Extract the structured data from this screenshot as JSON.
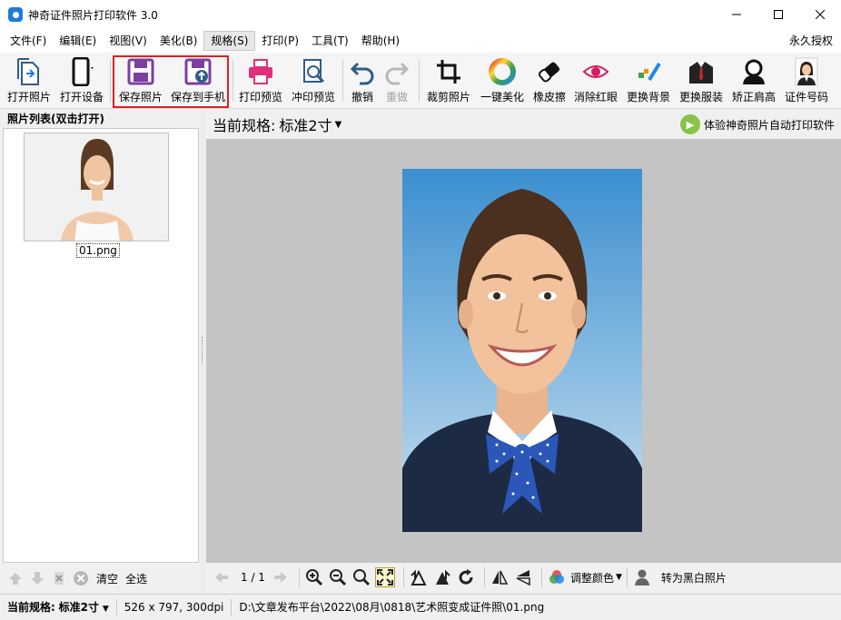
{
  "window": {
    "title": "神奇证件照片打印软件 3.0"
  },
  "menubar": {
    "items": [
      "文件(F)",
      "编辑(E)",
      "视图(V)",
      "美化(B)",
      "规格(S)",
      "打印(P)",
      "工具(T)",
      "帮助(H)"
    ],
    "active_index": 4,
    "right_label": "永久授权"
  },
  "toolbar": {
    "open_photo": "打开照片",
    "open_device": "打开设备",
    "save_photo": "保存照片",
    "save_to_phone": "保存到手机",
    "print_preview": "打印预览",
    "develop_preview": "冲印预览",
    "undo": "撤销",
    "redo": "重做",
    "crop": "裁剪照片",
    "one_click_beautify": "一键美化",
    "eraser": "橡皮擦",
    "remove_red_eye": "消除红眼",
    "change_background": "更换背景",
    "change_clothes": "更换服装",
    "correct_shoulder": "矫正肩高",
    "id_number": "证件号码"
  },
  "left_panel": {
    "header": "照片列表(双击打开)",
    "thumbnail_name": "01.png",
    "clear_label": "清空",
    "select_all_label": "全选"
  },
  "right_panel": {
    "spec_label": "当前规格:",
    "spec_value": "标准2寸",
    "promo_text": "体验神奇照片自动打印软件"
  },
  "bottom_bar": {
    "page_indicator": "1 / 1",
    "adjust_color": "调整颜色",
    "to_grayscale": "转为黑白照片"
  },
  "statusbar": {
    "spec_label": "当前规格:",
    "spec_value": "标准2寸",
    "dimensions": "526 x 797, 300dpi",
    "file_path": "D:\\文章发布平台\\2022\\08月\\0818\\艺术照变成证件照\\01.png"
  },
  "colors": {
    "accent": "#1e7ad8",
    "highlight_border": "#e02020",
    "save_icon": "#7b3fa0",
    "canvas_bg": "#c4c4c4"
  }
}
